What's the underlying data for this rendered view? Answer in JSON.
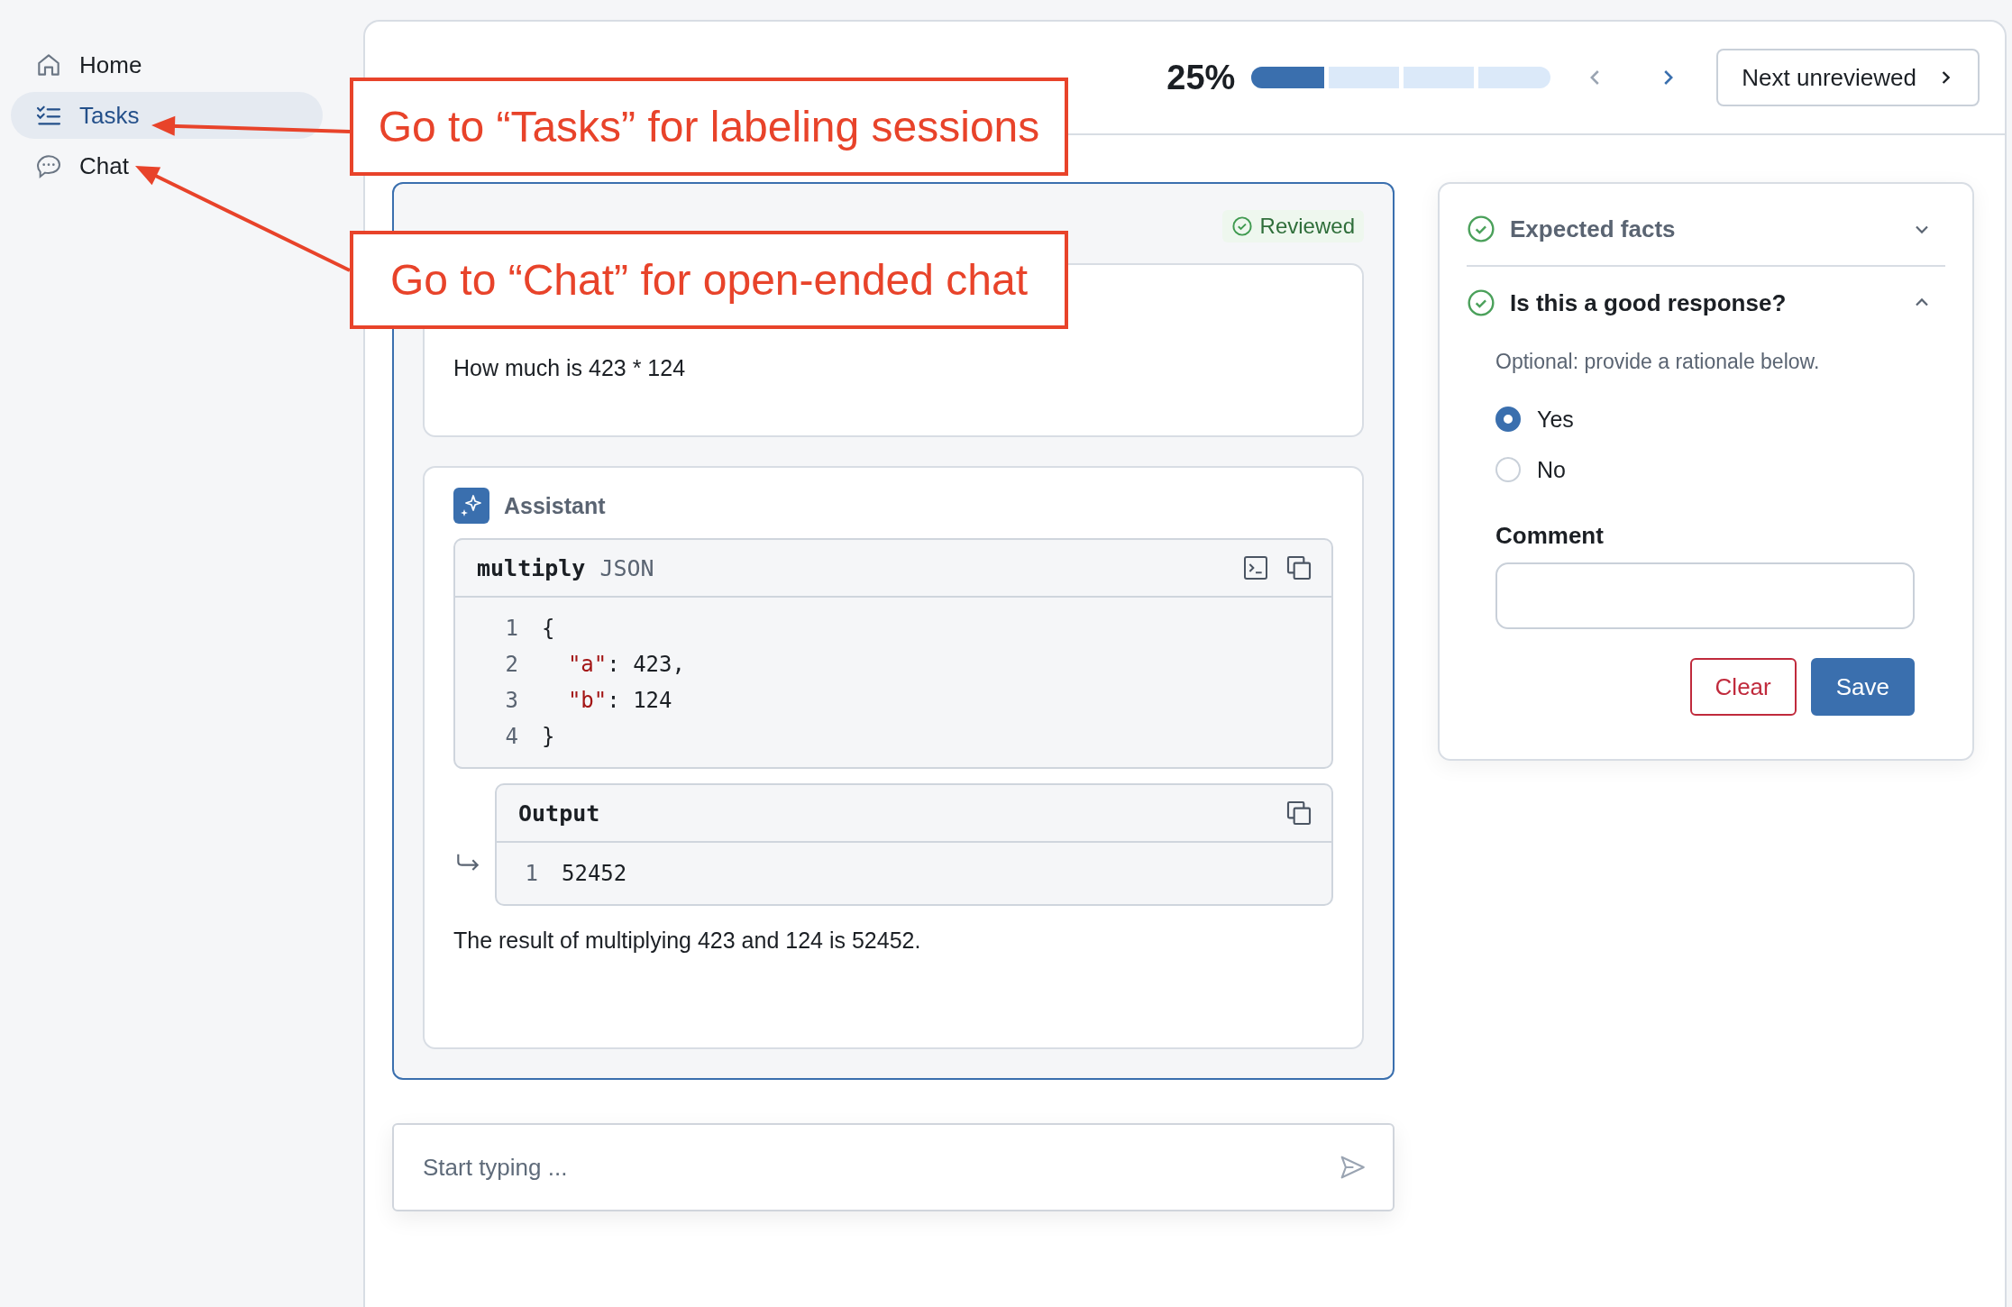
{
  "sidebar": {
    "items": [
      {
        "label": "Home",
        "selected": false
      },
      {
        "label": "Tasks",
        "selected": true
      },
      {
        "label": "Chat",
        "selected": false
      }
    ]
  },
  "header": {
    "progress_text": "25%",
    "progress": {
      "level": 0.25
    },
    "next_button": "Next unreviewed"
  },
  "chat": {
    "status": "Reviewed",
    "messages": [
      {
        "kind": "user",
        "text": "How much is 423 * 124"
      },
      {
        "kind": "assistant",
        "role": "Assistant",
        "tool_call": {
          "name": "multiply",
          "format": "JSON",
          "lines": [
            {
              "number": "1",
              "parts": [
                {
                  "kind": "plain",
                  "text": "{"
                }
              ]
            },
            {
              "number": "2",
              "parts": [
                {
                  "kind": "key",
                  "text": "  \"a\""
                },
                {
                  "kind": "plain",
                  "text": ": 423,"
                }
              ]
            },
            {
              "number": "3",
              "parts": [
                {
                  "kind": "key",
                  "text": "  \"b\""
                },
                {
                  "kind": "plain",
                  "text": ": 124"
                }
              ]
            },
            {
              "number": "4",
              "parts": [
                {
                  "kind": "plain",
                  "text": "}"
                }
              ]
            }
          ]
        },
        "output": {
          "title": "Output",
          "lines": [
            {
              "number": "1",
              "parts": [
                {
                  "kind": "plain",
                  "text": "52452"
                }
              ]
            }
          ]
        },
        "text": "The result of multiplying 423 and 124 is 52452."
      }
    ]
  },
  "composer": {
    "placeholder": "Start typing ..."
  },
  "review": {
    "sections": [
      {
        "title": "Expected facts",
        "done": true,
        "expanded": false
      },
      {
        "title": "Is this a good response?",
        "done": true,
        "expanded": true,
        "hint": "Optional: provide a rationale below.",
        "options": [
          {
            "label": "Yes",
            "selected": true
          },
          {
            "label": "No",
            "selected": false
          }
        ],
        "comment_label": "Comment",
        "buttons": [
          {
            "label": "Clear",
            "kind": "secondary"
          },
          {
            "label": "Save",
            "kind": "primary"
          }
        ]
      }
    ]
  },
  "annotations": [
    {
      "text": "Go to “Tasks” for labeling sessions"
    },
    {
      "text": "Go to “Chat” for open-ended chat"
    }
  ]
}
